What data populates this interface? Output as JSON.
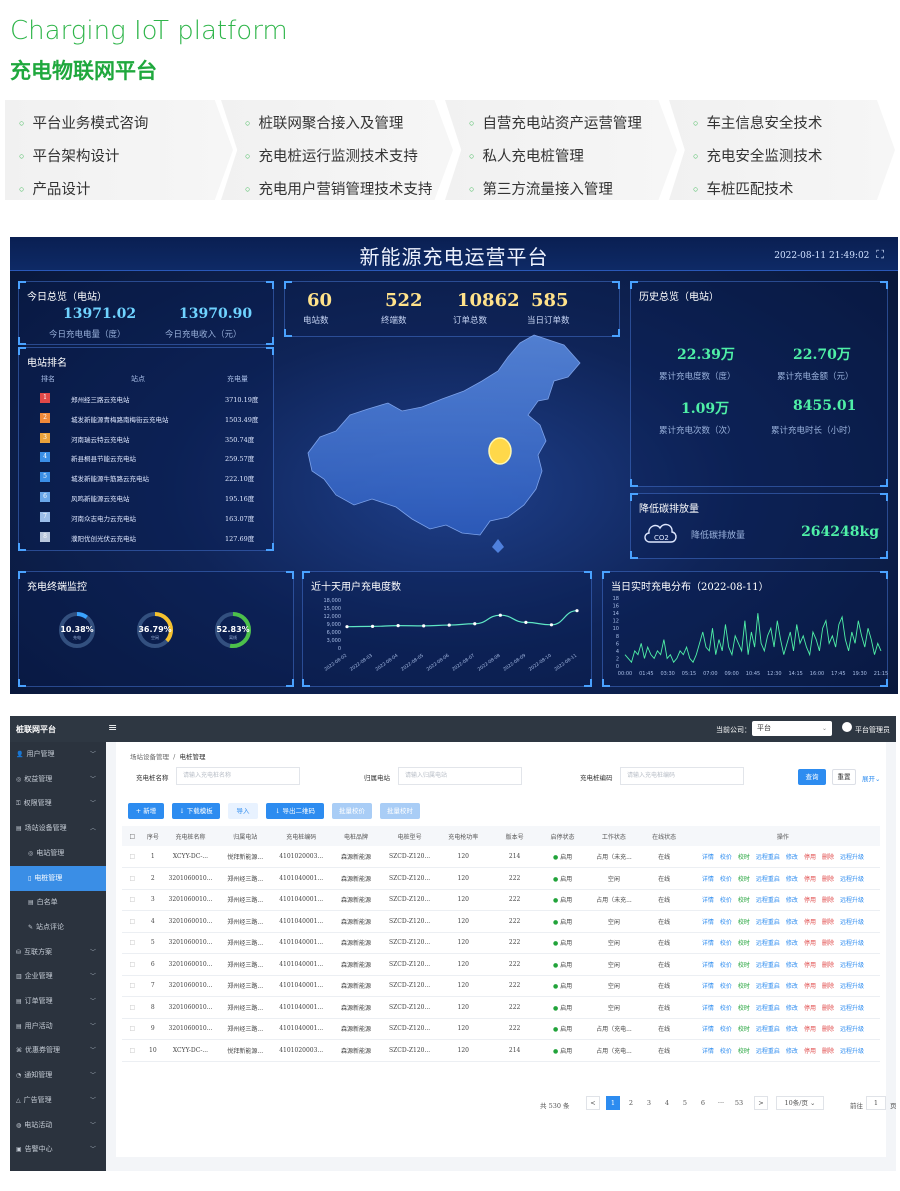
{
  "header": {
    "title_en": "Charging IoT platform",
    "title_cn": "充电物联网平台"
  },
  "features": [
    {
      "items": [
        "平台业务模式咨询",
        "平台架构设计",
        "产品设计"
      ]
    },
    {
      "items": [
        "桩联网聚合接入及管理",
        "充电桩运行监测技术支持",
        "充电用户营销管理技术支持"
      ]
    },
    {
      "items": [
        "自营充电站资产运营管理",
        "私人充电桩管理",
        "第三方流量接入管理"
      ]
    },
    {
      "items": [
        "车主信息安全技术",
        "充电安全监测技术",
        "车桩匹配技术"
      ]
    }
  ],
  "dashboard": {
    "title": "新能源充电运营平台",
    "datetime": "2022-08-11 21:49:02",
    "today": {
      "title": "今日总览（电站）",
      "energy": "13971.02",
      "energy_label": "今日充电电量（度）",
      "income": "13970.90",
      "income_label": "今日充电收入（元）"
    },
    "ranking": {
      "title": "电站排名",
      "headers": [
        "排名",
        "站点",
        "充电量"
      ],
      "rows": [
        {
          "rank": "1",
          "name": "郑州经三路云充电站",
          "value": "3710.19度",
          "color": "#e04848"
        },
        {
          "rank": "2",
          "name": "城发新能源青梅路南梅街云充电站",
          "value": "1503.49度",
          "color": "#f08a3a"
        },
        {
          "rank": "3",
          "name": "河南瑞云特云充电站",
          "value": "350.74度",
          "color": "#e9a23b"
        },
        {
          "rank": "4",
          "name": "新县桐县节能云充电站",
          "value": "259.57度",
          "color": "#3a8ee6"
        },
        {
          "rank": "5",
          "name": "城发新能源牛筋路云充电站",
          "value": "222.10度",
          "color": "#3a8ee6"
        },
        {
          "rank": "6",
          "name": "风鸣新能源云充电站",
          "value": "195.16度",
          "color": "#6aa7e8"
        },
        {
          "rank": "7",
          "name": "河南众志电力云充电站",
          "value": "163.07度",
          "color": "#9bbde8"
        },
        {
          "rank": "8",
          "name": "濮阳优创光伏云充电站",
          "value": "127.69度",
          "color": "#b8c6dc"
        }
      ]
    },
    "stats": [
      {
        "value": "60",
        "label": "电站数"
      },
      {
        "value": "522",
        "label": "终端数"
      },
      {
        "value": "10862",
        "label": "订单总数"
      },
      {
        "value": "585",
        "label": "当日订单数"
      }
    ],
    "history": {
      "title": "历史总览（电站）",
      "items": [
        {
          "value": "22.39万",
          "label": "累计充电度数（度）"
        },
        {
          "value": "22.70万",
          "label": "累计充电金额（元）"
        },
        {
          "value": "1.09万",
          "label": "累计充电次数（次）"
        },
        {
          "value": "8455.01",
          "label": "累计充电时长（小时）"
        }
      ]
    },
    "carbon": {
      "title": "降低碳排放量",
      "label": "降低碳排放量",
      "value": "264248kg",
      "icon": "co2-cloud-icon"
    },
    "monitor": {
      "title": "充电终端监控",
      "gauges": [
        {
          "value": "10.38%",
          "sub": "充电",
          "pct": 0.1038,
          "color": "#3aa3ff"
        },
        {
          "value": "36.79%",
          "sub": "空闲",
          "pct": 0.3679,
          "color": "#f5c12e"
        },
        {
          "value": "52.83%",
          "sub": "离线",
          "pct": 0.5283,
          "color": "#4cc04a"
        }
      ]
    },
    "chart_data": [
      {
        "type": "line",
        "title": "近十天用户充电度数",
        "x": [
          "2022-08-02",
          "2022-08-03",
          "2022-08-04",
          "2022-08-05",
          "2022-08-06",
          "2022-08-07",
          "2022-08-08",
          "2022-08-09",
          "2022-08-10",
          "2022-08-11"
        ],
        "values": [
          8000,
          8100,
          8400,
          8300,
          8600,
          9100,
          12300,
          9600,
          8700,
          14000
        ],
        "yticks": [
          "18,000",
          "15,000",
          "12,000",
          "9,000",
          "6,000",
          "3,000",
          "0"
        ],
        "ylim": [
          0,
          18000
        ]
      },
      {
        "type": "line",
        "title": "当日实时充电分布（2022-08-11）",
        "xticks": [
          "00:00",
          "01:45",
          "03:30",
          "05:15",
          "07:00",
          "09:00",
          "10:45",
          "12:30",
          "14:15",
          "16:00",
          "17:45",
          "19:30",
          "21:15"
        ],
        "yticks": [
          "18",
          "16",
          "14",
          "12",
          "10",
          "8",
          "6",
          "4",
          "2",
          "0"
        ],
        "ylim": [
          0,
          18
        ],
        "values": [
          3,
          2,
          1,
          4,
          3,
          6,
          2,
          5,
          3,
          2,
          4,
          3,
          7,
          2,
          3,
          1,
          2,
          4,
          3,
          5,
          2,
          1,
          3,
          6,
          9,
          5,
          4,
          10,
          3,
          7,
          4,
          11,
          5,
          3,
          8,
          6,
          4,
          12,
          3,
          9,
          5,
          14,
          6,
          4,
          8,
          10,
          5,
          12,
          7,
          3,
          6,
          9,
          4,
          11,
          6,
          8,
          5,
          3,
          9,
          7,
          4,
          10,
          12,
          6,
          8,
          5,
          11,
          13,
          7,
          4,
          9,
          6,
          12,
          8,
          5,
          10,
          7,
          3,
          6,
          4
        ]
      }
    ]
  },
  "admin": {
    "brand": "桩联网平台",
    "menu_icon": "menu-icon",
    "company_label": "当前公司：",
    "company_value": "平台",
    "user": "平台管理员",
    "sidebar": [
      {
        "label": "用户管理",
        "child": false
      },
      {
        "label": "权益管理",
        "child": false
      },
      {
        "label": "权限管理",
        "child": false
      },
      {
        "label": "场站设备管理",
        "child": false,
        "open": true
      },
      {
        "label": "电站管理",
        "child": true
      },
      {
        "label": "电桩管理",
        "child": true,
        "active": true
      },
      {
        "label": "白名单",
        "child": true
      },
      {
        "label": "站点评论",
        "child": true
      },
      {
        "label": "互联方案",
        "child": false
      },
      {
        "label": "企业管理",
        "child": false
      },
      {
        "label": "订单管理",
        "child": false
      },
      {
        "label": "用户活动",
        "child": false
      },
      {
        "label": "优惠券管理",
        "child": false
      },
      {
        "label": "通知管理",
        "child": false
      },
      {
        "label": "广告管理",
        "child": false
      },
      {
        "label": "电站活动",
        "child": false
      },
      {
        "label": "告警中心",
        "child": false
      }
    ],
    "breadcrumb": [
      "场站设备管理",
      "电桩管理"
    ],
    "filters": [
      {
        "label": "充电桩名称",
        "placeholder": "请输入充电桩名称"
      },
      {
        "label": "归属电站",
        "placeholder": "请输入归属电站"
      },
      {
        "label": "充电桩编码",
        "placeholder": "请输入充电桩编码"
      }
    ],
    "query": "查询",
    "reset": "重置",
    "expand": "展开",
    "toolbar": [
      "+ 新增",
      "↓ 下载模板",
      "导入",
      "↓ 导出二维码",
      "批量校价",
      "批量校时"
    ],
    "columns": [
      "序号",
      "充电桩名称",
      "归属电站",
      "充电桩编码",
      "电桩品牌",
      "电桩型号",
      "充电枪功率",
      "版本号",
      "启停状态",
      "工作状态",
      "在线状态",
      "操作"
    ],
    "rows": [
      [
        "1",
        "XCYY-DC-...",
        "悦拜新能源...",
        "4101020003...",
        "森源新能源",
        "SZCD-Z120...",
        "120",
        "214",
        "启用",
        "占用（未充...",
        "在线"
      ],
      [
        "2",
        "3201060010...",
        "郑州经三路...",
        "4101040001...",
        "森源新能源",
        "SZCD-Z120...",
        "120",
        "222",
        "启用",
        "空闲",
        "在线"
      ],
      [
        "3",
        "3201060010...",
        "郑州经三路...",
        "4101040001...",
        "森源新能源",
        "SZCD-Z120...",
        "120",
        "222",
        "启用",
        "占用（未充...",
        "在线"
      ],
      [
        "4",
        "3201060010...",
        "郑州经三路...",
        "4101040001...",
        "森源新能源",
        "SZCD-Z120...",
        "120",
        "222",
        "启用",
        "空闲",
        "在线"
      ],
      [
        "5",
        "3201060010...",
        "郑州经三路...",
        "4101040001...",
        "森源新能源",
        "SZCD-Z120...",
        "120",
        "222",
        "启用",
        "空闲",
        "在线"
      ],
      [
        "6",
        "3201060010...",
        "郑州经三路...",
        "4101040001...",
        "森源新能源",
        "SZCD-Z120...",
        "120",
        "222",
        "启用",
        "空闲",
        "在线"
      ],
      [
        "7",
        "3201060010...",
        "郑州经三路...",
        "4101040001...",
        "森源新能源",
        "SZCD-Z120...",
        "120",
        "222",
        "启用",
        "空闲",
        "在线"
      ],
      [
        "8",
        "3201060010...",
        "郑州经三路...",
        "4101040001...",
        "森源新能源",
        "SZCD-Z120...",
        "120",
        "222",
        "启用",
        "空闲",
        "在线"
      ],
      [
        "9",
        "3201060010...",
        "郑州经三路...",
        "4101040001...",
        "森源新能源",
        "SZCD-Z120...",
        "120",
        "222",
        "启用",
        "占用（充电...",
        "在线"
      ],
      [
        "10",
        "XCYY-DC-...",
        "悦拜新能源...",
        "4101020003...",
        "森源新能源",
        "SZCD-Z120...",
        "120",
        "214",
        "启用",
        "占用（充电...",
        "在线"
      ]
    ],
    "ops": [
      "详情",
      "校价",
      "校时",
      "远程重启",
      "修改",
      "停用",
      "删除",
      "远程升级"
    ],
    "pagination": {
      "total": "共 530 条",
      "pages": [
        "1",
        "2",
        "3",
        "4",
        "5",
        "6",
        "···",
        "53"
      ],
      "per_page": "10条/页",
      "goto": "前往",
      "goto_value": "1",
      "goto_suffix": "页"
    }
  },
  "colors": {
    "brand_green": "#2fb54a",
    "dash_bg": "#0f2458",
    "accent_blue": "#3a8ee6",
    "admin_dark": "#2b333e",
    "op_green": "#21a33a",
    "op_red": "#e04848"
  }
}
